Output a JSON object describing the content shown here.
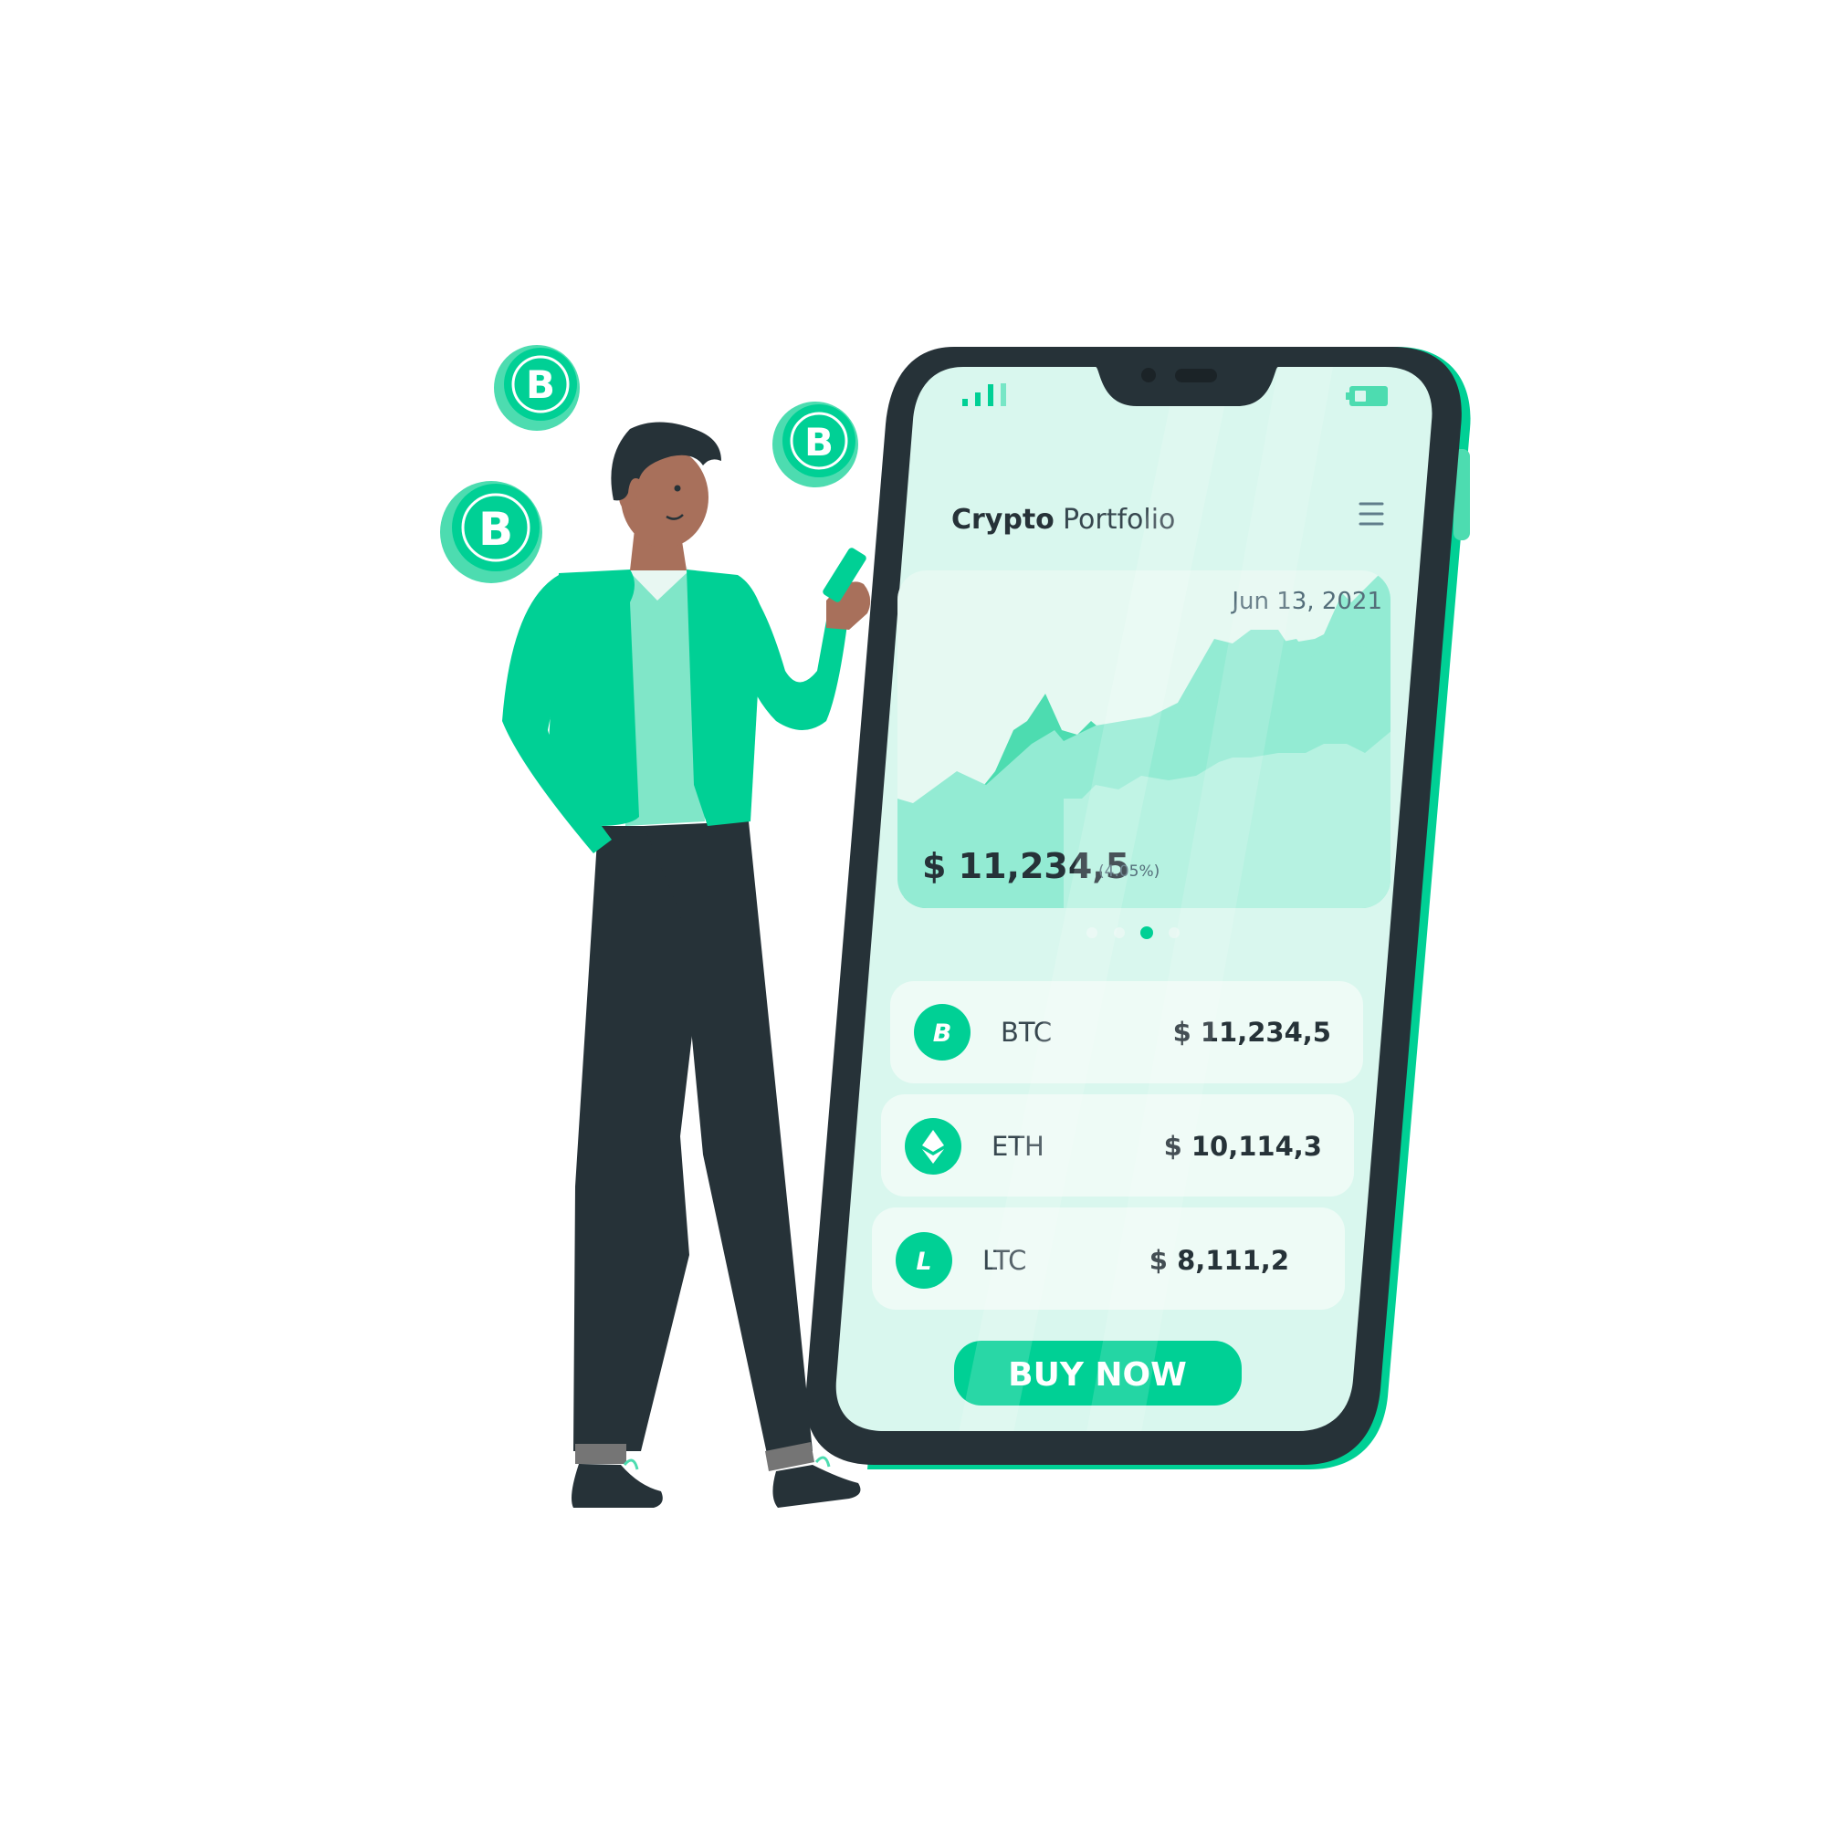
{
  "app": {
    "title_bold": "Crypto",
    "title_light": "Portfolio",
    "menu_icon": "hamburger-menu-icon"
  },
  "status_bar": {
    "signal_icon": "signal-bars-icon",
    "battery_icon": "battery-icon"
  },
  "chart_card": {
    "date": "Jun 13, 2021",
    "price": "$ 11,234,5",
    "change": "(4.05%)"
  },
  "carousel": {
    "count": 4,
    "active_index": 2
  },
  "coins": [
    {
      "letter": "B",
      "symbol": "BTC",
      "price": "$ 11,234,5",
      "icon": "bitcoin-icon"
    },
    {
      "letter": "",
      "symbol": "ETH",
      "price": "$ 10,114,3",
      "icon": "ethereum-icon"
    },
    {
      "letter": "L",
      "symbol": "LTC",
      "price": "$ 8,111,2",
      "icon": "litecoin-icon"
    }
  ],
  "buy_button": {
    "label": "BUY NOW"
  },
  "floating_coins": {
    "letter": "B",
    "icon": "bitcoin-coin-icon"
  },
  "colors": {
    "accent": "#00d095",
    "dark": "#263238",
    "screen": "#d9f7ee",
    "card": "#eefbf6"
  }
}
